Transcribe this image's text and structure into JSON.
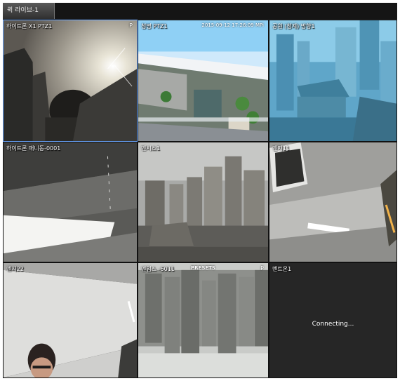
{
  "window": {
    "tab_label": "퀵 라이브-1"
  },
  "tiles": [
    {
      "label": "하이트론 X1 PTZ1",
      "mode": "P"
    },
    {
      "label": "청명 PTZ1",
      "timestamp": "2015-09-12 17:26:09 MPi"
    },
    {
      "label": "공원 (청계) 방향1"
    },
    {
      "label": "하이트론 매니동-0001"
    },
    {
      "label": "멘시스1"
    },
    {
      "label": "멘지11"
    },
    {
      "label": "멘지22"
    },
    {
      "label": "멘임스 -6011",
      "center_text": "PRESETS",
      "mode": "P"
    },
    {
      "label": "멘트온1",
      "status": "Connecting..."
    }
  ]
}
